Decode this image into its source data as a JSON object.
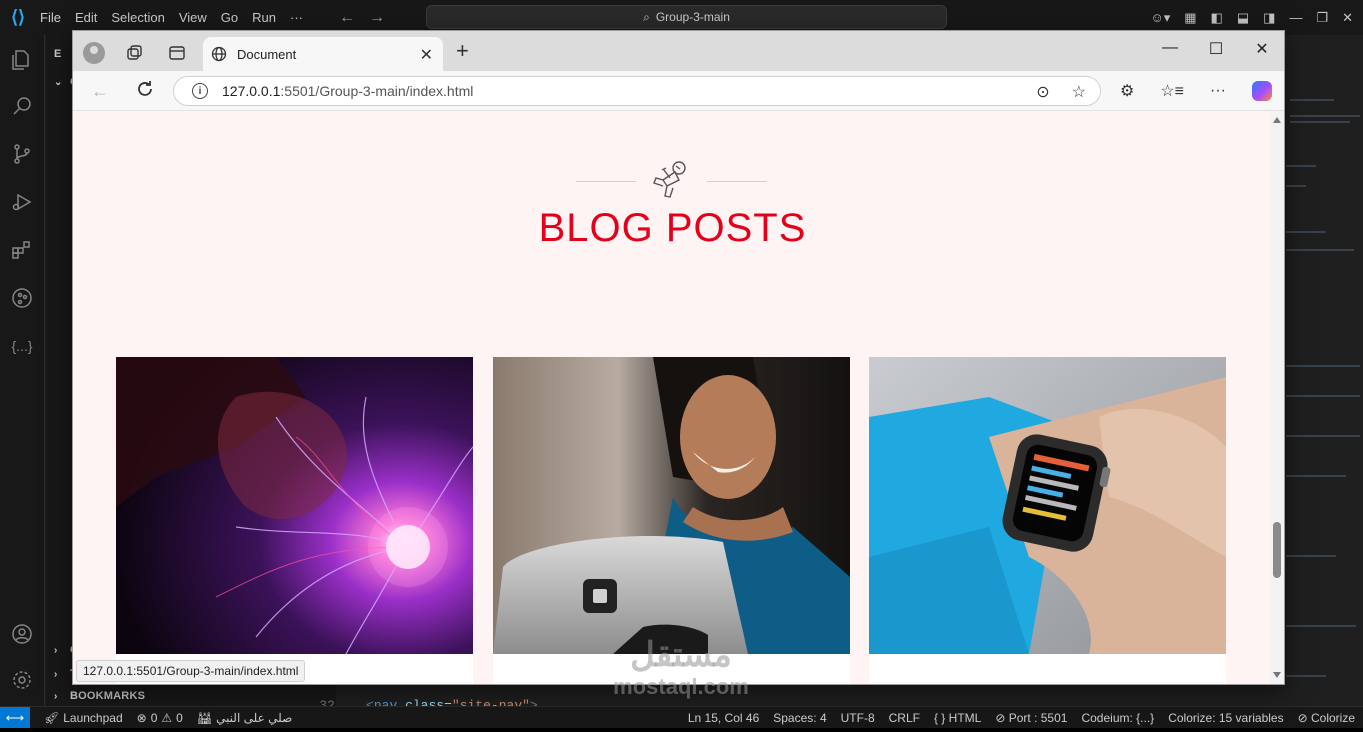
{
  "vscode": {
    "menu": [
      "File",
      "Edit",
      "Selection",
      "View",
      "Go",
      "Run",
      "···"
    ],
    "search_label": "Group-3-main",
    "sidebar": {
      "explorer_letter": "E",
      "group_label": "G",
      "outline_label": "O",
      "timeline_label": "T",
      "bookmarks_label": "BOOKMARKS"
    },
    "code_lines": [
      {
        "num": "32",
        "indent": "    ",
        "open": "<",
        "tag": "nav",
        "attr": "class",
        "eq": "=",
        "value": "\"site-nav\"",
        "close": ">"
      }
    ],
    "status": {
      "launchpad": "Launchpad",
      "errors": "0",
      "warnings": "0",
      "arabic_text": "صلي على النبي",
      "position": "Ln 15, Col 46",
      "spaces": "Spaces: 4",
      "encoding": "UTF-8",
      "eol": "CRLF",
      "language": "HTML",
      "port": "Port : 5501",
      "codeium": "Codeium: {...}",
      "colorize_vars": "Colorize: 15 variables",
      "colorize": "Colorize"
    }
  },
  "browser": {
    "tab_title": "Document",
    "url_host": "127.0.0.1",
    "url_rest": ":5501/Group-3-main/index.html",
    "status_url": "127.0.0.1:5501/Group-3-main/index.html"
  },
  "page": {
    "section_title": "BLOG POSTS",
    "cards": [
      {
        "image": "plasma-ball",
        "meta": ""
      },
      {
        "image": "woman-laptop",
        "meta": ""
      },
      {
        "image": "smartwatch",
        "meta": ""
      }
    ]
  },
  "watermark": {
    "arabic": "مستقل",
    "latin": "mostaql.com"
  },
  "colors": {
    "title_red": "#e3001b",
    "page_bg": "#fdf4f3",
    "vscode_accent": "#0078d4"
  }
}
